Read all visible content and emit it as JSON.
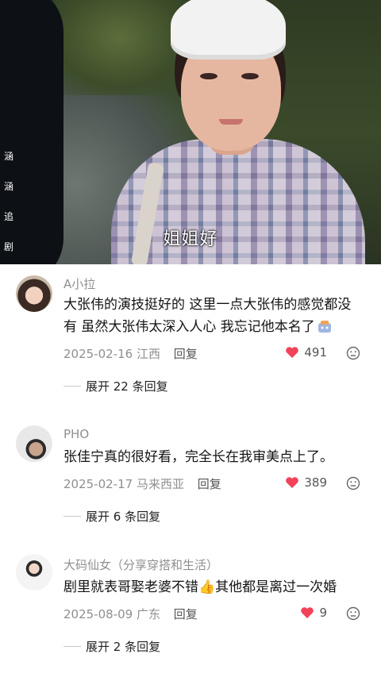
{
  "video": {
    "side_watermark": [
      "涵",
      "涵",
      "追",
      "剧"
    ],
    "subtitle": "姐姐好"
  },
  "comments": [
    {
      "username": "A小拉",
      "text_line1": "大张伟的演技挺好的 这里一点大张伟的感觉都没",
      "text_line2": "有 虽然大张伟太深入人心 我忘记他本名了",
      "date": "2025-02-16",
      "location": "江西",
      "reply_label": "回复",
      "likes": "491",
      "expand_label": "展开 22 条回复"
    },
    {
      "username": "PHO",
      "text_line1": "张佳宁真的很好看，完全长在我审美点上了。",
      "date": "2025-02-17",
      "location": "马来西亚",
      "reply_label": "回复",
      "likes": "389",
      "expand_label": "展开 6 条回复"
    },
    {
      "username": "大码仙女（分享穿搭和生活）",
      "text_line1": "剧里就表哥娶老婆不错👍其他都是离过一次婚",
      "date": "2025-08-09",
      "location": "广东",
      "reply_label": "回复",
      "likes": "9",
      "expand_label": "展开 2 条回复"
    }
  ],
  "colors": {
    "heart": "#f2425a",
    "meta_gray": "#8f8f8f"
  }
}
